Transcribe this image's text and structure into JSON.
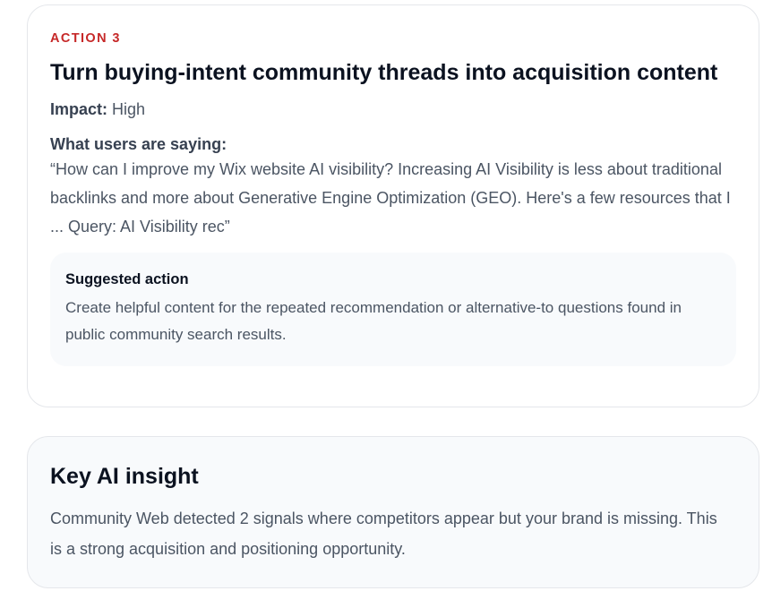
{
  "action_card": {
    "eyebrow": "ACTION 3",
    "title": "Turn buying-intent community threads into acquisition content",
    "impact_label": "Impact:",
    "impact_value": "High",
    "saying_label": "What users are saying:",
    "quote": "“How can I improve my Wix website AI visibility? Increasing AI Visibility is less about traditional backlinks and more about Generative Engine Optimization (GEO). Here's a few resources that I ... Query: AI Visibility rec”",
    "suggested": {
      "title": "Suggested action",
      "body": "Create helpful content for the repeated recommendation or alternative-to questions found in public community search results."
    }
  },
  "insight_card": {
    "title": "Key AI insight",
    "body": "Community Web detected 2 signals where competitors appear but your brand is missing. This is a strong acquisition and positioning opportunity."
  },
  "colors": {
    "accent_red": "#c62828",
    "heading": "#0b1220",
    "body_text": "#4b5563",
    "panel_bg": "#f8fafc",
    "border": "#e5e7eb"
  }
}
